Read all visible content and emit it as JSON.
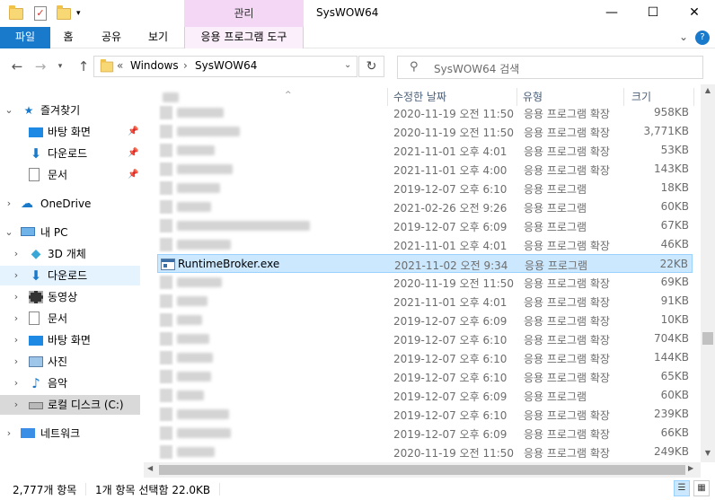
{
  "window": {
    "title": "SysWOW64",
    "contextual_tab_group": "관리",
    "minimize": "—",
    "maximize": "☐",
    "close": "✕"
  },
  "ribbon": {
    "tabs": [
      "파일",
      "홈",
      "공유",
      "보기",
      "응용 프로그램 도구"
    ],
    "collapse": "⌄",
    "help": "?"
  },
  "address": {
    "overflow": "«",
    "crumbs": [
      "Windows",
      "SysWOW64"
    ],
    "sep": "›"
  },
  "search": {
    "placeholder": "SysWOW64 검색"
  },
  "nav": {
    "quick_access": "즐겨찾기",
    "desktop": "바탕 화면",
    "downloads": "다운로드",
    "documents": "문서",
    "onedrive": "OneDrive",
    "this_pc": "내 PC",
    "objects3d": "3D 개체",
    "pc_downloads": "다운로드",
    "videos": "동영상",
    "pc_documents": "문서",
    "pc_desktop": "바탕 화면",
    "pictures": "사진",
    "music": "음악",
    "local_disk": "로컬 디스크 (C:)",
    "network": "네트워크"
  },
  "columns": {
    "date": "수정한 날짜",
    "type": "유형",
    "size": "크기"
  },
  "files": [
    {
      "name": "",
      "date": "2020-11-19 오전 11:50",
      "type": "응용 프로그램 확장",
      "size": "958KB"
    },
    {
      "name": "",
      "date": "2020-11-19 오전 11:50",
      "type": "응용 프로그램 확장",
      "size": "3,771KB"
    },
    {
      "name": "",
      "date": "2021-11-01 오후 4:01",
      "type": "응용 프로그램 확장",
      "size": "53KB"
    },
    {
      "name": "",
      "date": "2021-11-01 오후 4:00",
      "type": "응용 프로그램 확장",
      "size": "143KB"
    },
    {
      "name": "",
      "date": "2019-12-07 오후 6:10",
      "type": "응용 프로그램",
      "size": "18KB"
    },
    {
      "name": "",
      "date": "2021-02-26 오전 9:26",
      "type": "응용 프로그램",
      "size": "60KB"
    },
    {
      "name": "",
      "date": "2019-12-07 오후 6:09",
      "type": "응용 프로그램",
      "size": "67KB"
    },
    {
      "name": "",
      "date": "2021-11-01 오후 4:01",
      "type": "응용 프로그램 확장",
      "size": "46KB"
    },
    {
      "name": "RuntimeBroker.exe",
      "date": "2021-11-02 오전 9:34",
      "type": "응용 프로그램",
      "size": "22KB"
    },
    {
      "name": "",
      "date": "2020-11-19 오전 11:50",
      "type": "응용 프로그램 확장",
      "size": "69KB"
    },
    {
      "name": "",
      "date": "2021-11-01 오후 4:01",
      "type": "응용 프로그램 확장",
      "size": "91KB"
    },
    {
      "name": "",
      "date": "2019-12-07 오후 6:09",
      "type": "응용 프로그램 확장",
      "size": "10KB"
    },
    {
      "name": "",
      "date": "2019-12-07 오후 6:10",
      "type": "응용 프로그램 확장",
      "size": "704KB"
    },
    {
      "name": "",
      "date": "2019-12-07 오후 6:10",
      "type": "응용 프로그램 확장",
      "size": "144KB"
    },
    {
      "name": "",
      "date": "2019-12-07 오후 6:10",
      "type": "응용 프로그램 확장",
      "size": "65KB"
    },
    {
      "name": "",
      "date": "2019-12-07 오후 6:09",
      "type": "응용 프로그램",
      "size": "60KB"
    },
    {
      "name": "",
      "date": "2019-12-07 오후 6:10",
      "type": "응용 프로그램 확장",
      "size": "239KB"
    },
    {
      "name": "",
      "date": "2019-12-07 오후 6:09",
      "type": "응용 프로그램 확장",
      "size": "66KB"
    },
    {
      "name": "",
      "date": "2020-11-19 오전 11:50",
      "type": "응용 프로그램 확장",
      "size": "249KB"
    }
  ],
  "status": {
    "count": "2,777개 항목",
    "selection": "1개 항목 선택함 22.0KB"
  }
}
